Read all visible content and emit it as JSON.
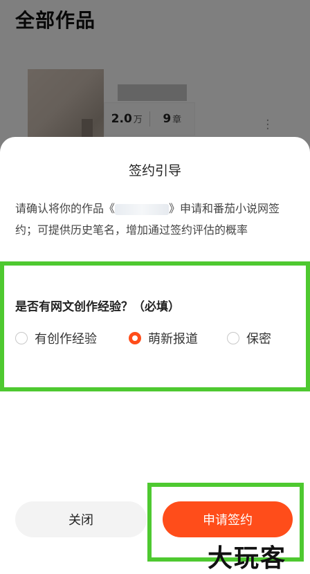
{
  "background": {
    "page_title": "全部作品",
    "stats": {
      "words_value": "2.0",
      "words_unit": "万",
      "chapters_value": "9",
      "chapters_unit": "章"
    },
    "more_icon": "more-vertical-icon"
  },
  "sheet": {
    "title": "签约引导",
    "desc_part1": "请确认将你的作品《",
    "desc_part2": "》申请和番茄小说网签约；可提供历史笔名，增加通过签约评估的概率",
    "question": "是否有网文创作经验？（必填）",
    "options": [
      {
        "label": "有创作经验",
        "checked": false
      },
      {
        "label": "萌新报道",
        "checked": true
      },
      {
        "label": "保密",
        "checked": false
      }
    ],
    "close_label": "关闭",
    "apply_label": "申请签约"
  },
  "watermark": "大玩客",
  "colors": {
    "accent": "#ff4d1a",
    "highlight": "#4ec930"
  }
}
